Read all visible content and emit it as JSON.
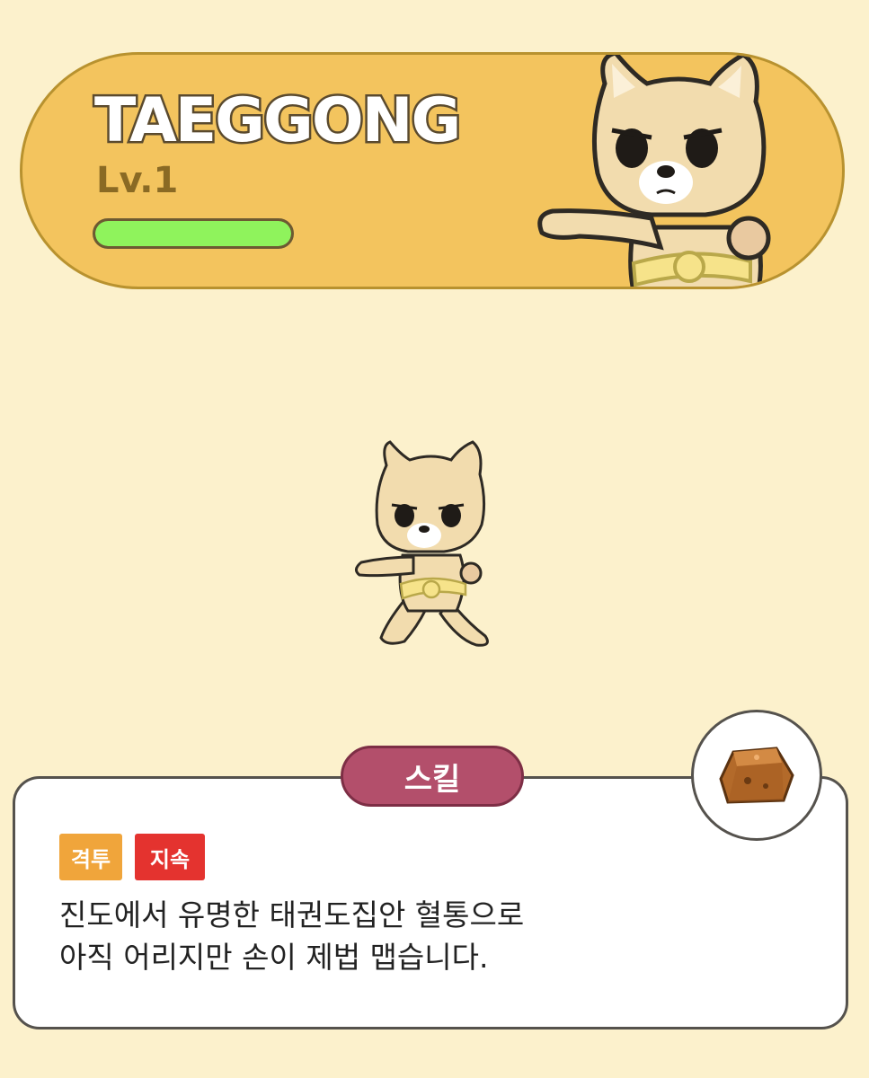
{
  "character": {
    "name": "TAEGGONG",
    "level": "Lv.1",
    "xp_fraction": 1.0
  },
  "skill": {
    "title": "스킬",
    "tags": [
      "격투",
      "지속"
    ],
    "description_line1": "진도에서 유명한 태권도집안 혈통으로",
    "description_line2": "아직 어리지만 손이 제법 맵습니다."
  },
  "colors": {
    "background": "#fcf1cc",
    "header": "#f3c45e",
    "xp_fill": "#8ff35c",
    "skill_title": "#b34f6b",
    "tag_fight": "#f0a53b",
    "tag_duration": "#e4332f"
  },
  "icons": {
    "portrait": "shiba-taekwondo-portrait",
    "sprite": "shiba-taekwondo-sprite",
    "skill": "rock-block-icon"
  }
}
